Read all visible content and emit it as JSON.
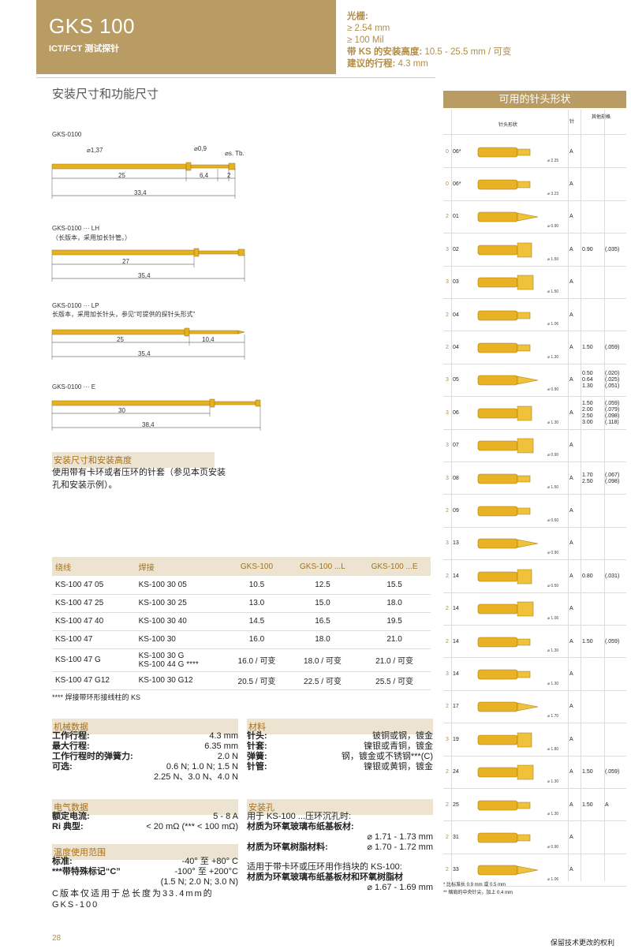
{
  "header": {
    "title": "GKS 100",
    "subtitle": "ICT/FCT 测试探针"
  },
  "spec": {
    "l1": "光栅:",
    "l2": "≥ 2.54 mm",
    "l3": "≥ 100 Mil",
    "l4_label": "带 KS 的安装高度:",
    "l4_val": "10.5 - 25.5 mm / 可变",
    "l5_label": "建议的行程:",
    "l5_val": "4.3 mm"
  },
  "section_title": "安装尺寸和功能尺寸",
  "drawings": {
    "d1": {
      "title": "GKS-0100",
      "dia1": "⌀1,37",
      "dia2": "⌀0,9",
      "tip": "⌀s. Tb.",
      "l1": "25",
      "l2": "6,4",
      "l3": "2",
      "total": "33,4"
    },
    "d2": {
      "title": "GKS-0100 ··· LH",
      "desc": "（长版本，采用加长针管。）",
      "l1": "27",
      "total": "35,4"
    },
    "d3": {
      "title": "GKS-0100 ··· LP",
      "desc": "长版本，采用加长针头，参见“可提供的探针头形式”",
      "l1": "25",
      "l2": "10,4",
      "total": "35,4"
    },
    "d4": {
      "title": "GKS-0100 ··· E",
      "l1": "30",
      "total": "38,4"
    }
  },
  "install": {
    "title": "安装尺寸和安装高度",
    "l1": "使用带有卡环或者压环的针套（参见本页安装",
    "l2": "孔和安装示例）。"
  },
  "sleeve_table": {
    "headers": [
      "绕线",
      "焊接",
      "GKS-100",
      "GKS-100 ...L",
      "GKS-100 ...E"
    ],
    "rows": [
      [
        "KS-100 47 05",
        "KS-100 30 05",
        "10.5",
        "12.5",
        "15.5"
      ],
      [
        "KS-100 47 25",
        "KS-100 30 25",
        "13.0",
        "15.0",
        "18.0"
      ],
      [
        "KS-100 47 40",
        "KS-100 30 40",
        "14.5",
        "16.5",
        "19.5"
      ],
      [
        "KS-100 47",
        "KS-100 30",
        "16.0",
        "18.0",
        "21.0"
      ],
      [
        "KS-100 47 G",
        "KS-100 30 G\nKS-100 44 G ****",
        "16.0 / 可变",
        "18.0 / 可变",
        "21.0 / 可变"
      ],
      [
        "KS-100 47 G12",
        "KS-100 30 G12",
        "20.5 / 可变",
        "22.5 / 可变",
        "25.5 / 可变"
      ]
    ],
    "footnote": "**** 焊接带环形接线柱的 KS"
  },
  "mech": {
    "title": "机械数据",
    "rows": [
      [
        "工作行程:",
        "4.3 mm"
      ],
      [
        "最大行程:",
        "6.35 mm"
      ],
      [
        "工作行程时的弹簧力:",
        "2.0 N"
      ],
      [
        "可选:",
        "0.6 N; 1.0 N; 1.5 N"
      ],
      [
        "",
        "2.25 N、3.0 N、4.0 N"
      ]
    ]
  },
  "material": {
    "title": "材料",
    "rows": [
      [
        "针头:",
        "铍铜或钢，镀金"
      ],
      [
        "针套:",
        "镍银或青铜，镀金"
      ],
      [
        "弹簧:",
        "钢，镀金或不锈钢***(C)"
      ],
      [
        "针管:",
        "镍银或黄铜，镀金"
      ]
    ]
  },
  "elec": {
    "title": "电气数据",
    "rows": [
      [
        "额定电流:",
        "5 - 8 A"
      ],
      [
        "Ri 典型:",
        "< 20 mΩ (*** < 100 mΩ)"
      ]
    ]
  },
  "temp": {
    "title": "温度使用范围",
    "rows": [
      [
        "标准:",
        "-40° 至 +80° C"
      ],
      [
        "***带特殊标记“C”",
        "-100° 至 +200°C"
      ],
      [
        "",
        "(1.5 N; 2.0 N; 3.0 N)"
      ]
    ],
    "note": "C版本仅适用于总长度为33.4mm的 GKS-100"
  },
  "hole": {
    "title": "安装孔",
    "l1": "用于 KS-100 ...压环沉孔时:",
    "l2": "材质为环氧玻璃布纸基板材:",
    "l3": "⌀ 1.71 - 1.73 mm",
    "l4": "材质为环氧树脂材料:",
    "l5": "⌀ 1.70 - 1.72 mm",
    "l6": "适用于带卡环或压环用作挡块的 KS-100:",
    "l7": "材质为环氧玻璃布纸基板材和环氧树脂材",
    "l8": "⌀ 1.67 - 1.69 mm"
  },
  "pins": {
    "title": "可用的针头形状",
    "col_head": "针头形状",
    "col_a": "针",
    "col_alt": "其他规格",
    "rows": [
      {
        "n": "0",
        "s": "06*",
        "d": "⌀ 2.25",
        "a": "A",
        "v1": "",
        "v2": ""
      },
      {
        "n": "0",
        "s": "06*",
        "d": "⌀ 3.23",
        "a": "A",
        "v1": "",
        "v2": ""
      },
      {
        "n": "2",
        "s": "01",
        "d": "⌀ 0.90",
        "a": "A",
        "v1": "",
        "v2": ""
      },
      {
        "n": "3",
        "s": "02",
        "d": "⌀ 1.50",
        "a": "A",
        "v1": "0.90",
        "v2": "(.035)"
      },
      {
        "n": "3",
        "s": "03",
        "d": "⌀ 1.50",
        "a": "A",
        "v1": "",
        "v2": ""
      },
      {
        "n": "2",
        "s": "04",
        "d": "⌀ 1.06",
        "a": "A",
        "v1": "",
        "v2": ""
      },
      {
        "n": "2",
        "s": "04",
        "d": "⌀ 1.30",
        "a": "A",
        "v1": "1.50",
        "v2": "(.059)"
      },
      {
        "n": "3",
        "s": "05",
        "d": "⌀ 0.90",
        "a": "A",
        "v1": "0.50\n0.64\n1.30",
        "v2": "(.020)\n(.025)\n(.051)"
      },
      {
        "n": "3",
        "s": "06",
        "d": "⌀ 1.30",
        "a": "A",
        "v1": "1.50\n2.00\n2.50\n3.00",
        "v2": "(.059)\n(.079)\n(.098)\n(.118)"
      },
      {
        "n": "3",
        "s": "07",
        "d": "⌀ 0.90",
        "a": "A",
        "v1": "",
        "v2": ""
      },
      {
        "n": "3",
        "s": "08",
        "d": "⌀ 1.50",
        "a": "A",
        "v1": "1.70\n2.50",
        "v2": "(.067)\n(.098)"
      },
      {
        "n": "2",
        "s": "09",
        "d": "⌀ 0.60",
        "a": "A",
        "v1": "",
        "v2": ""
      },
      {
        "n": "3",
        "s": "13",
        "d": "⌀ 0.90",
        "a": "A",
        "v1": "",
        "v2": ""
      },
      {
        "n": "2",
        "s": "14",
        "d": "⌀ 0.50",
        "a": "A",
        "v1": "0.80",
        "v2": "(.031)"
      },
      {
        "n": "2",
        "s": "14",
        "d": "⌀ 1.06",
        "a": "A",
        "v1": "",
        "v2": ""
      },
      {
        "n": "2",
        "s": "14",
        "d": "⌀ 1.30",
        "a": "A",
        "v1": "1.50",
        "v2": "(.059)"
      },
      {
        "n": "3",
        "s": "14",
        "d": "⌀ 1.30",
        "a": "A",
        "v1": "",
        "v2": ""
      },
      {
        "n": "2",
        "s": "17",
        "d": "⌀ 1.70",
        "a": "A",
        "v1": "",
        "v2": ""
      },
      {
        "n": "3",
        "s": "19",
        "d": "⌀ 1.80",
        "a": "A",
        "v1": "",
        "v2": ""
      },
      {
        "n": "2",
        "s": "24",
        "d": "⌀ 1.30",
        "a": "A",
        "v1": "1.50",
        "v2": "(.059)"
      },
      {
        "n": "2",
        "s": "25",
        "d": "⌀ 1.30",
        "a": "A",
        "v1": "1.50",
        "v2": "A"
      },
      {
        "n": "2",
        "s": "31",
        "d": "⌀ 0.90",
        "a": "A",
        "v1": "",
        "v2": ""
      },
      {
        "n": "2",
        "s": "33",
        "d": "⌀ 1.06",
        "a": "A",
        "v1": "",
        "v2": ""
      }
    ],
    "note1": "* 比标准长 0.9 mm 或 0.5 mm",
    "note2": "** 缩肩的中央针尖，加上 0.4 mm"
  },
  "footer": {
    "page": "28",
    "right": "保留技术更改的权利"
  }
}
